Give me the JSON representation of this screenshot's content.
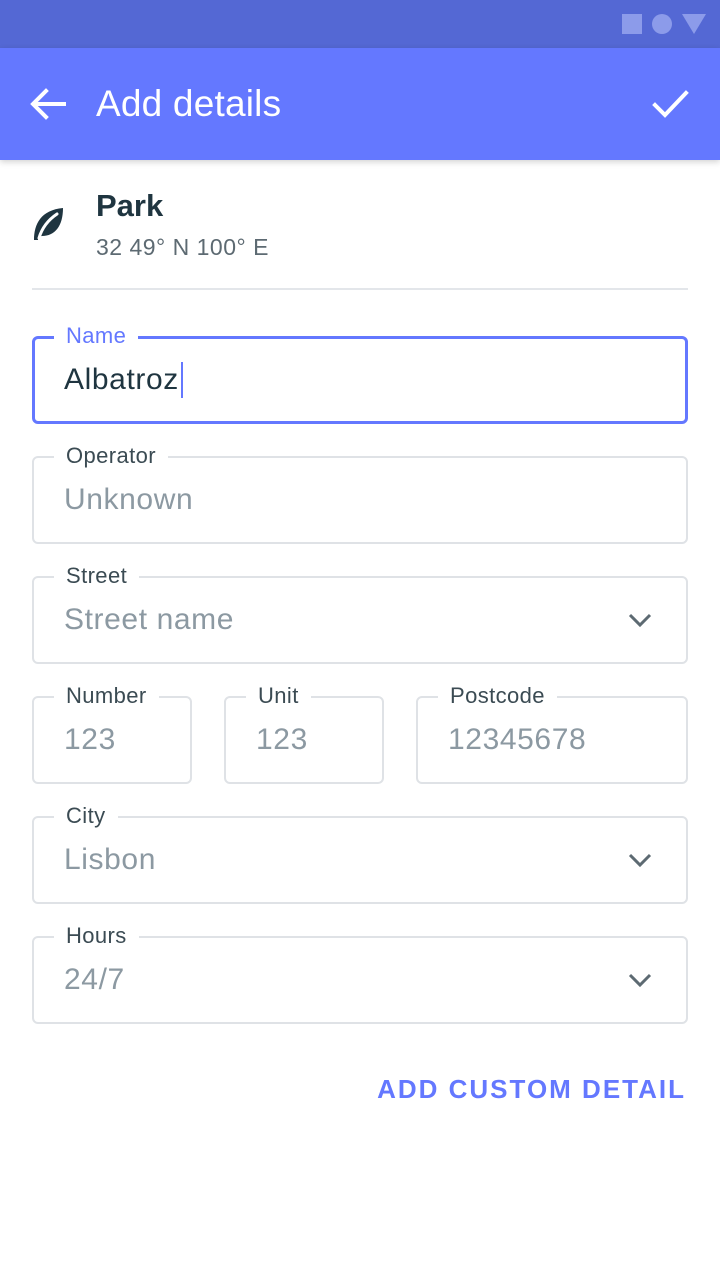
{
  "colors": {
    "status_bar": "#5468d4",
    "app_bar": "#6478ff",
    "accent": "#6478ff",
    "text_primary": "#1f3540",
    "text_hint": "#8c99a2",
    "border": "#dfe2e6"
  },
  "status_bar": {
    "icons": [
      "square-icon",
      "circle-icon",
      "triangle-icon"
    ]
  },
  "app_bar": {
    "back_icon": "arrow-left-icon",
    "title": "Add details",
    "confirm_icon": "check-icon"
  },
  "place": {
    "icon": "leaf-icon",
    "name": "Park",
    "coordinates": "32 49° N 100° E"
  },
  "fields": {
    "name": {
      "label": "Name",
      "value": "Albatroz",
      "focused": true
    },
    "operator": {
      "label": "Operator",
      "placeholder": "Unknown"
    },
    "street": {
      "label": "Street",
      "placeholder": "Street name",
      "icon": "chevron-down-icon"
    },
    "number": {
      "label": "Number",
      "placeholder": "123"
    },
    "unit": {
      "label": "Unit",
      "placeholder": "123"
    },
    "postcode": {
      "label": "Postcode",
      "placeholder": "12345678"
    },
    "city": {
      "label": "City",
      "value": "Lisbon",
      "icon": "chevron-down-icon"
    },
    "hours": {
      "label": "Hours",
      "value": "24/7",
      "icon": "chevron-down-icon"
    }
  },
  "actions": {
    "add_custom_detail": "ADD CUSTOM DETAIL"
  }
}
